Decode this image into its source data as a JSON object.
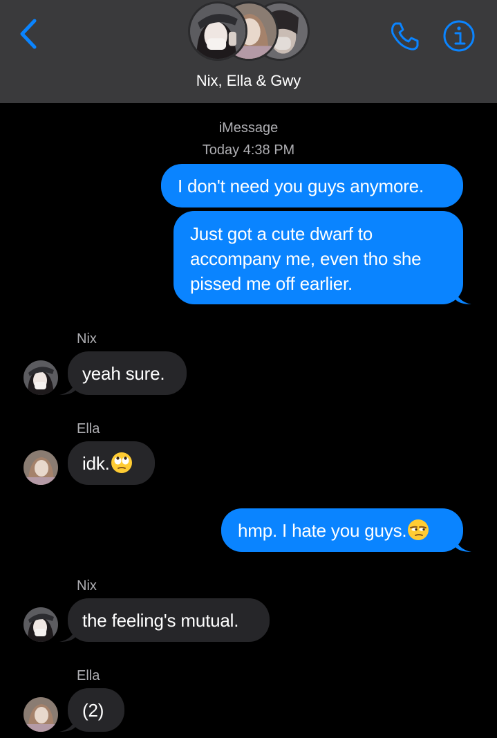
{
  "header": {
    "back_icon": "chevron-left-icon",
    "title": "Nix, Ella & Gwy",
    "call_icon": "phone-icon",
    "info_icon": "info-icon",
    "accent": "#0a84ff"
  },
  "thread": {
    "service": "iMessage",
    "timestamp": "Today 4:38 PM"
  },
  "messages": [
    {
      "from": "me",
      "text": "I don't need you guys anymore."
    },
    {
      "from": "me",
      "lines": [
        "Just got a cute dwarf to",
        "accompany me, even tho she",
        "pissed me off earlier."
      ]
    },
    {
      "from": "Nix",
      "sender": "Nix",
      "text": "yeah sure."
    },
    {
      "from": "Ella",
      "sender": "Ella",
      "text": "idk.",
      "emoji": "face-with-rolling-eyes-emoji"
    },
    {
      "from": "me",
      "text": "hmp. I hate you guys.",
      "emoji": "unamused-face-emoji"
    },
    {
      "from": "Nix",
      "sender": "Nix",
      "text": "the feeling's mutual."
    },
    {
      "from": "Ella",
      "sender": "Ella",
      "text": "(2)"
    }
  ],
  "colors": {
    "sent_bubble": "#0a84ff",
    "received_bubble": "#262629",
    "header_bg": "#3a3a3c"
  }
}
